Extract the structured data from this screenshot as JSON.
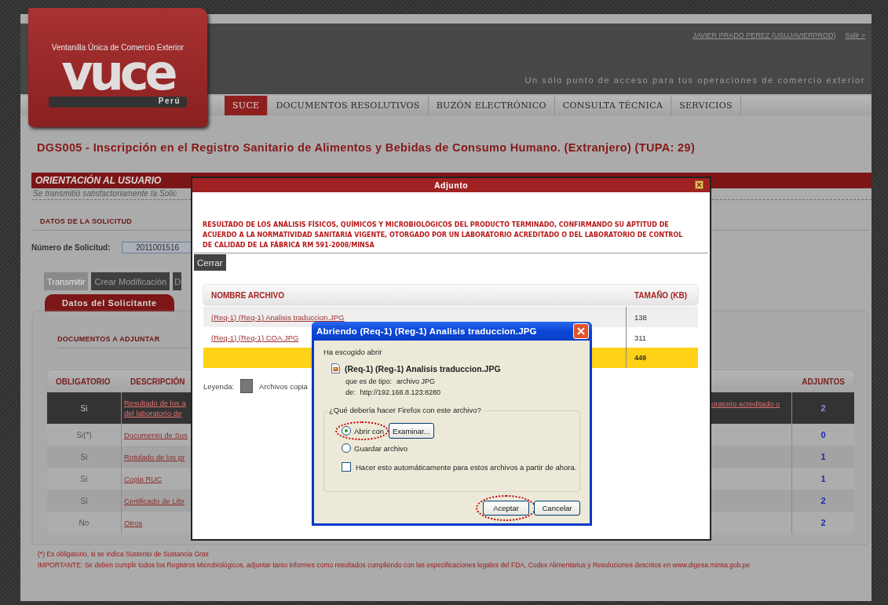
{
  "header": {
    "logo": {
      "subtitle": "Ventanilla Única de Comercio Exterior",
      "wordmark": "vuce",
      "country": "Perú"
    },
    "user_link": "JAVIER PRADO PEREZ (USUJAVIERPROD)",
    "logout_link": "Salir »",
    "tagline": "Un sólo punto de acceso para tus operaciones de comercio exterior"
  },
  "nav": [
    {
      "label": "SUCE",
      "selected": true
    },
    {
      "label": "DOCUMENTOS RESOLUTIVOS",
      "selected": false
    },
    {
      "label": "BUZÓN ELECTRÓNICO",
      "selected": false
    },
    {
      "label": "CONSULTA TÉCNICA",
      "selected": false
    },
    {
      "label": "SERVICIOS",
      "selected": false
    }
  ],
  "page_title": "DGS005 - Inscripción en el Registro Sanitario de Alimentos y Bebidas de Consumo Humano. (Extranjero) (TUPA: 29)",
  "orientation": {
    "title": "ORIENTACIÓN AL USUARIO",
    "message": "Se transmitió satisfactoriamente la Solic"
  },
  "request": {
    "section_title": "DATOS DE LA SOLICITUD",
    "number_label": "Número de Solicitud:",
    "number_value": "2011001516"
  },
  "actions": [
    {
      "label": "Transmitir",
      "disabled": true
    },
    {
      "label": "Crear Modificación",
      "disabled": false
    },
    {
      "label": "D",
      "disabled": false
    }
  ],
  "tabs": [
    {
      "label": "Datos del Solicitante",
      "selected": true
    }
  ],
  "documents": {
    "title": "DOCUMENTOS A ADJUNTAR",
    "columns": [
      "OBLIGATORIO",
      "DESCRIPCIÓN",
      "ADJUNTOS"
    ],
    "rows": [
      {
        "mandatory": "Si",
        "description": [
          "Resultado de los a",
          "del laboratorio de"
        ],
        "description_tail": "oratorio acreditado o",
        "attachments": "2",
        "selected": true
      },
      {
        "mandatory": "Si(*)",
        "description": [
          "Documento de Sus"
        ],
        "attachments": "0",
        "selected": false
      },
      {
        "mandatory": "Si",
        "description": [
          "Rotulado de los pr"
        ],
        "attachments": "1",
        "selected": false
      },
      {
        "mandatory": "Si",
        "description": [
          "Copia RUC"
        ],
        "attachments": "1",
        "selected": false
      },
      {
        "mandatory": "Si",
        "description": [
          "Certificado de Libr"
        ],
        "attachments": "2",
        "selected": false
      },
      {
        "mandatory": "No",
        "description": [
          "Otros"
        ],
        "attachments": "2",
        "selected": false
      }
    ]
  },
  "notes": [
    "(*) Es obligatorio, si se indica Sustento de Sustancia Gras",
    "IMPORTANTE: Se deben cumplir todos los Registros Microbiológicos, adjuntar tanto informes como resultados cumpliendo con las especificaciones legales del FDA, Codex Alimentarius y Resoluciones descritos en www.digesa.minsa.gob.pe"
  ],
  "attachment_dialog": {
    "title": "Adjunto",
    "heading": "RESULTADO DE LOS ANÁLISIS FÍSICOS, QUÍMICOS Y MICROBIOLÓGICOS DEL PRODUCTO TERMINADO, CONFIRMANDO SU APTITUD DE ACUERDO A LA NORMATIVIDAD SANITARIA VIGENTE, OTORGADO POR UN LABORATORIO ACREDITADO O DEL LABORATORIO DE CONTROL DE CALIDAD DE LA FÁBRICA RM 591-2008/MINSA",
    "close_button": "Cerrar",
    "columns": [
      "NOMBRE ARCHIVO",
      "TAMAÑO (KB)"
    ],
    "files": [
      {
        "name": "(Req-1) (Req-1) Analisis traduccion.JPG",
        "size": "138"
      },
      {
        "name": "(Req-1) (Req-1) COA.JPG",
        "size": "311"
      }
    ],
    "total": "449",
    "legend_label": "Leyenda:",
    "legend_item": "Archivos copia"
  },
  "open_dialog": {
    "title": "Abriendo (Req-1) (Reg-1) Analisis traduccion.JPG",
    "intro": "Ha escogido abrir",
    "file_name": "(Req-1) (Reg-1) Analisis traduccion.JPG",
    "type_label": "que es de tipo:",
    "type_value": "archivo JPG",
    "from_label": "de:",
    "from_value": "http://192.168.8.123:8280",
    "question": "¿Qué debería hacer Firefox con este archivo?",
    "options": [
      {
        "label": "Abrir con",
        "selected": true,
        "annotated": true
      },
      {
        "label": "Guardar archivo",
        "selected": false,
        "annotated": false
      }
    ],
    "browse_button": "Examinar...",
    "remember": {
      "label": "Hacer esto automáticamente para estos archivos a partir de ahora.",
      "checked": false
    },
    "buttons": [
      {
        "label": "Aceptar",
        "annotated": true
      },
      {
        "label": "Cancelar",
        "annotated": false
      }
    ]
  }
}
